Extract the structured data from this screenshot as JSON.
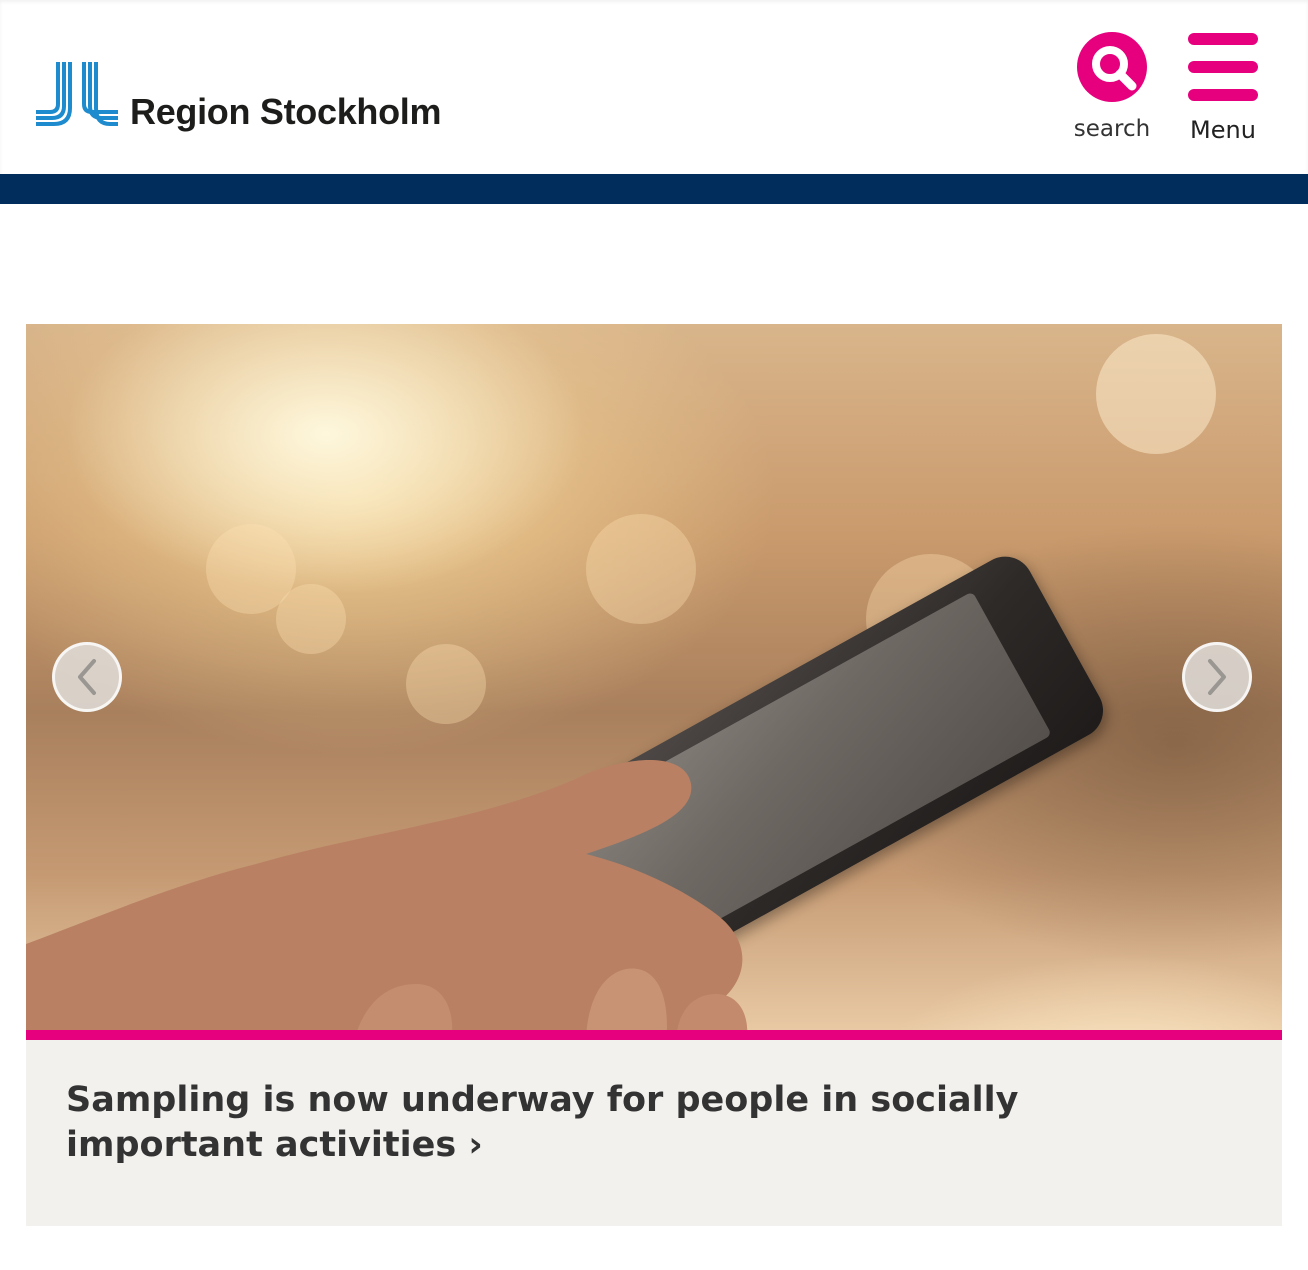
{
  "header": {
    "logo_text": "Region Stockholm",
    "search_label": "search",
    "menu_label": "Menu"
  },
  "carousel": {
    "slide": {
      "image_alt": "Hand holding a smartphone against a sunlit, blurred background",
      "caption": "Sampling is now underway for people in socially important activities",
      "caption_arrow": "›"
    },
    "prev_label": "Previous slide",
    "next_label": "Next slide"
  },
  "colors": {
    "accent": "#e6007e",
    "navy": "#002d5c",
    "logo_blue": "#1d8bcd",
    "caption_bg": "#f3f1ee"
  },
  "icons": {
    "search": "search-icon",
    "menu": "hamburger-menu-icon",
    "prev": "chevron-left-icon",
    "next": "chevron-right-icon"
  }
}
